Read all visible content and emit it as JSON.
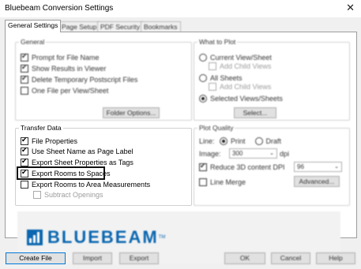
{
  "window": {
    "title": "Bluebeam Conversion Settings",
    "close_glyph": "✕"
  },
  "tabs": [
    "General Settings",
    "Page Setup",
    "PDF Security",
    "Bookmarks"
  ],
  "general": {
    "title": "General",
    "options": [
      {
        "label": "Prompt for File Name",
        "checked": true
      },
      {
        "label": "Show Results in Viewer",
        "checked": true
      },
      {
        "label": "Delete Temporary Postscript Files",
        "checked": true
      },
      {
        "label": "One File per View/Sheet",
        "checked": false
      }
    ],
    "folder_button": "Folder Options..."
  },
  "what_to_plot": {
    "title": "What to Plot",
    "current_view": "Current View/Sheet",
    "current_children": "Add Child Views",
    "all_sheets": "All Sheets",
    "all_children": "Add Child Views",
    "selected": "Selected Views/Sheets",
    "select_button": "Select..."
  },
  "transfer_data": {
    "title": "Transfer Data",
    "options": [
      {
        "label": "File Properties",
        "checked": true
      },
      {
        "label": "Use Sheet Name as Page Label",
        "checked": true
      },
      {
        "label": "Export Sheet Properties as Tags",
        "checked": true
      },
      {
        "label": "Export Rooms to Spaces",
        "checked": true
      },
      {
        "label": "Export Rooms to Area Measurements",
        "checked": false
      },
      {
        "label": "Subtract Openings",
        "checked": false
      }
    ]
  },
  "plot_quality": {
    "title": "Plot Quality",
    "line_label": "Line:",
    "print": "Print",
    "draft": "Draft",
    "image_label": "Image:",
    "image_dpi": "300",
    "dpi_unit": "dpi",
    "reduce_3d": "Reduce 3D content DPI",
    "reduce_dpi": "96",
    "line_merge": "Line Merge",
    "advanced_button": "Advanced..."
  },
  "brand": {
    "name": "BLUEBEAM",
    "tm": "TM",
    "color": "#0a66b0"
  },
  "buttons": {
    "create_file": "Create File",
    "import": "Import",
    "export": "Export",
    "ok": "OK",
    "cancel": "Cancel",
    "help": "Help"
  }
}
